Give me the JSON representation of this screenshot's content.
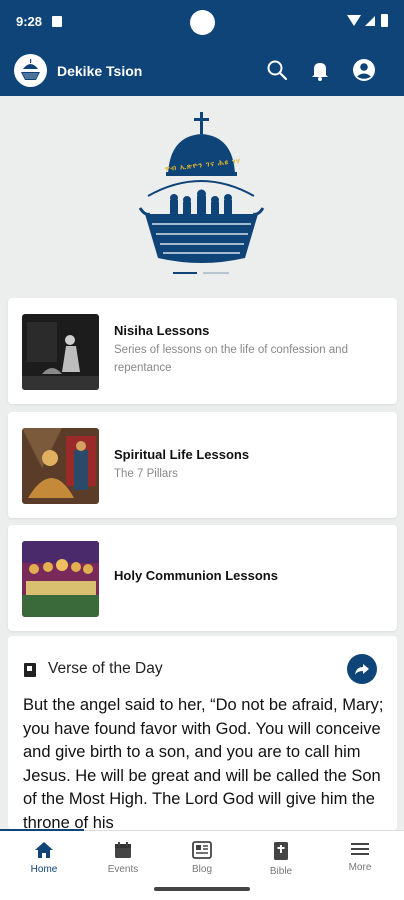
{
  "status": {
    "time": "9:28"
  },
  "app": {
    "title": "Dekike Tsion",
    "icons": [
      "search-icon",
      "bell-icon",
      "account-icon"
    ]
  },
  "hero": {
    "arc_text": "ዋብ ኢጽዮን ገና ሕዩ ገሃ"
  },
  "lessons": [
    {
      "title": "Nisiha Lessons",
      "subtitle": "Series of lessons on the life of confession and repentance"
    },
    {
      "title": "Spiritual Life Lessons",
      "subtitle": "The 7 Pillars"
    },
    {
      "title": "Holy Communion Lessons",
      "subtitle": ""
    }
  ],
  "verse": {
    "title": "Verse of the Day",
    "text": "But the angel said to her, “Do not be afraid, Mary; you have found favor with God. You will conceive and give birth to a son, and you are to call him Jesus. He will be great and will be called the Son of the Most High. The Lord God will give him the throne of his"
  },
  "nav": {
    "items": [
      {
        "label": "Home",
        "icon": "home-icon",
        "active": true
      },
      {
        "label": "Events",
        "icon": "calendar-icon"
      },
      {
        "label": "Blog",
        "icon": "blog-icon"
      },
      {
        "label": "Bible",
        "icon": "bible-icon"
      },
      {
        "label": "More",
        "icon": "menu-icon"
      }
    ]
  },
  "colors": {
    "primary": "#0f4478",
    "background": "#eceeee",
    "card": "#ffffff",
    "logo_gold": "#e6b92c"
  }
}
